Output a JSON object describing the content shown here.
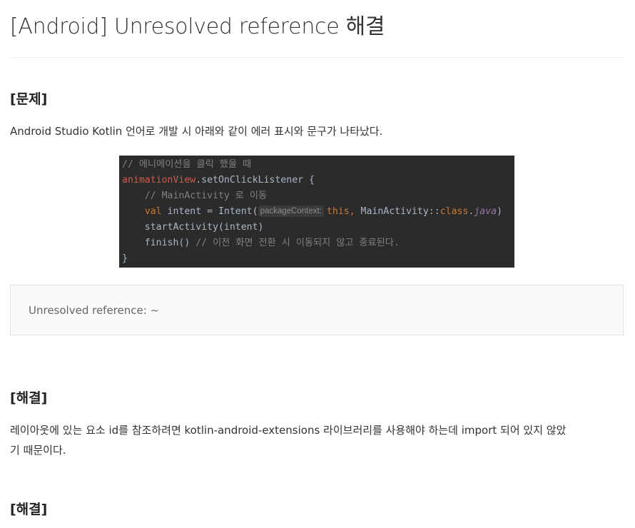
{
  "page": {
    "title": "[Android] Unresolved reference 해결"
  },
  "sections": [
    {
      "heading": "[문제]",
      "text": "Android Studio Kotlin 언어로 개발 시 아래와 같이 에러 표시와 문구가 나타났다."
    },
    {
      "heading": "[해결]",
      "text_line1": "레이아웃에 있는 요소 id를 참조하려면 kotlin-android-extensions 라이브러리를 사용해야 하는데 import 되어 있지 않았",
      "text_line2": "기 때문이다."
    },
    {
      "heading": "[해결]"
    }
  ],
  "code": {
    "line1_comment": "// 에니메이션을 클릭 했을 때",
    "line2_prop": "animationView",
    "line2_rest": ".setOnClickListener {",
    "line3_comment": "// MainActivity 로 이동",
    "line4_val": "val",
    "line4_mid": " intent = Intent(",
    "line4_hint": "packageContext:",
    "line4_this": "this,",
    "line4_class_ref": " MainActivity::",
    "line4_class": "class",
    "line4_dot": ".",
    "line4_java": "java",
    "line4_close": ")",
    "line5": "startActivity(intent)",
    "line6_call": "finish()",
    "line6_comment": " // 이전 화면 전환 시 이동되지 않고 종료된다.",
    "line7": "}"
  },
  "quote": {
    "text": "Unresolved reference: ~"
  }
}
